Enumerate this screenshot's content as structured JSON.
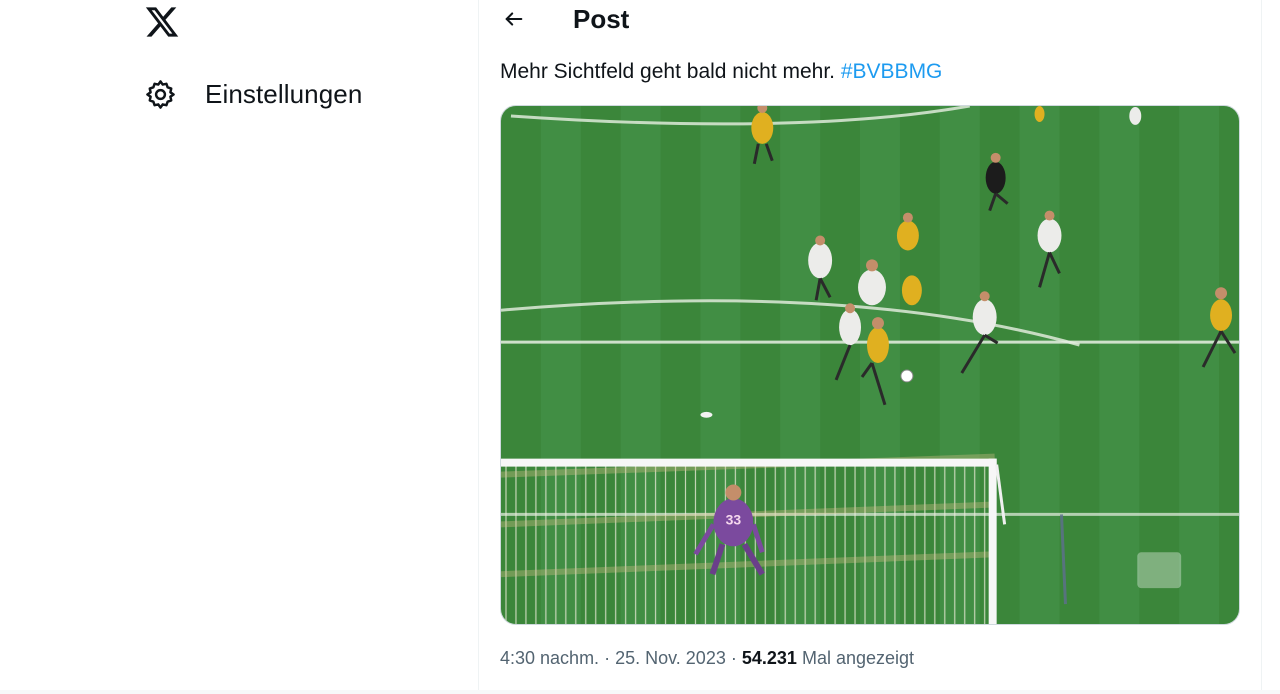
{
  "sidebar": {
    "logo_icon": "x-logo-icon",
    "items": [
      {
        "label": "Einstellungen",
        "icon": "gear-icon"
      }
    ]
  },
  "header": {
    "back_icon": "arrow-left-icon",
    "title": "Post"
  },
  "post": {
    "text": "Mehr Sichtfeld geht bald nicht mehr.",
    "hashtag": "#BVBBMG",
    "media": {
      "description_icon": "football-match-photo",
      "goalkeeper_number": "33"
    },
    "meta": {
      "time": "4:30 nachm.",
      "separator": "·",
      "date": "25. Nov. 2023",
      "views_count": "54.231",
      "views_label": "Mal angezeigt"
    }
  },
  "colors": {
    "accent": "#1d9bf0",
    "text": "#0f1419",
    "secondary": "#536471",
    "border": "#eff3f4",
    "pitch": "#3f8a3c"
  }
}
